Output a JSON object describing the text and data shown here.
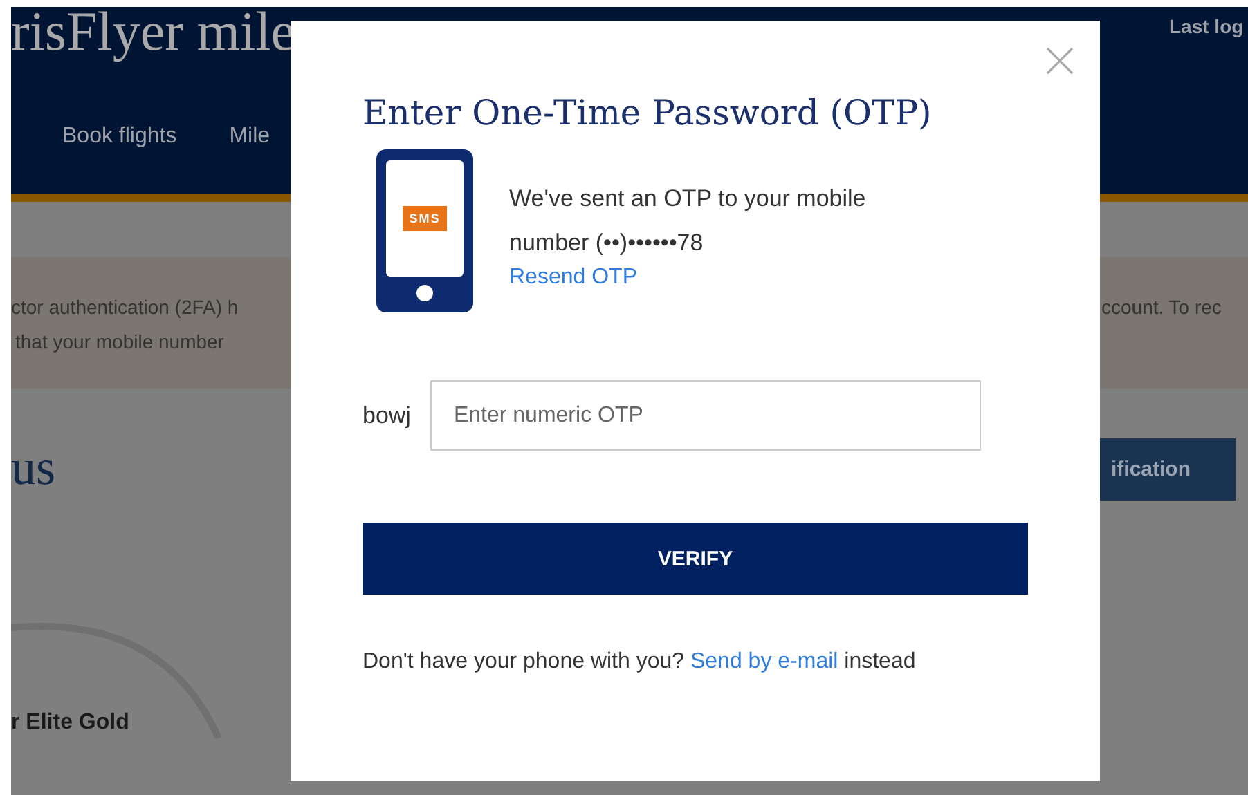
{
  "header": {
    "title": "risFlyer mile",
    "nav": [
      {
        "label": "Book flights"
      },
      {
        "label": "Mile"
      }
    ],
    "last_login": "Last log"
  },
  "banner": {
    "left_lines": [
      "ctor authentication (2FA) h",
      "that your mobile number"
    ],
    "right_line": "ccount. To rec"
  },
  "section": {
    "heading": "us",
    "button": "ification",
    "tier": "r Elite Gold"
  },
  "dialog": {
    "title": "Enter One-Time Password (OTP)",
    "icon_badge": "SMS",
    "message_lines": [
      "We've sent an OTP to your mobile",
      "number (••)••••••78"
    ],
    "resend_link": "Resend OTP",
    "field_label": "bowj",
    "otp_field": {
      "placeholder": "Enter numeric OTP"
    },
    "verify_button": "VERIFY",
    "footer": {
      "text": "Don't have your phone with you?",
      "link": "Send by e-mail",
      "after": "instead"
    }
  }
}
